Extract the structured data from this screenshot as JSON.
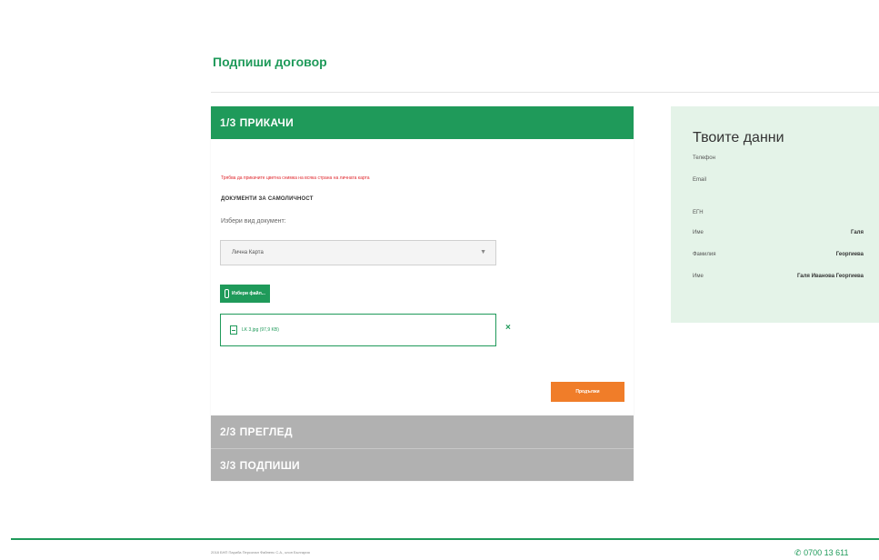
{
  "page": {
    "title": "Подпиши договор"
  },
  "wizard": {
    "steps": [
      {
        "number": "1/3",
        "label": "ПРИКАЧИ",
        "active": true
      },
      {
        "number": "2/3",
        "label": "ПРЕГЛЕД",
        "active": false
      },
      {
        "number": "3/3",
        "label": "ПОДПИШИ",
        "active": false
      }
    ],
    "error_message": "Трябва да прикачите цветна снимка на всяка страна на личната карта",
    "section_heading": "ДОКУМЕНТИ ЗА САМОЛИЧНОСТ",
    "select_label": "Избери вид документ:",
    "select_value": "Лична Карта",
    "choose_file_label": "Избери файл...",
    "uploaded_file": "LK 3.jpg (97,9 KB)",
    "remove_symbol": "×",
    "continue_label": "Продължи"
  },
  "data_panel": {
    "title": "Твоите данни",
    "rows": [
      {
        "label": "Телефон",
        "value": ""
      },
      {
        "label": "Email",
        "value": ""
      },
      {
        "label": "ЕГН",
        "value": ""
      },
      {
        "label": "Име",
        "value": "Галя"
      },
      {
        "label": "Фамилия",
        "value": "Георгиева"
      },
      {
        "label": "Име",
        "value": "Галя Иванова Георгиева"
      }
    ]
  },
  "footer": {
    "copyright": "2018 БНП Париба Персонал Файненс С.А., клон България",
    "phone": "0700 13 611"
  },
  "colors": {
    "accent": "#1f9a5a",
    "orange": "#f07d29",
    "error": "#e0282e",
    "inactive_step": "#b1b1b1",
    "panel_bg": "#e4f3e8"
  }
}
